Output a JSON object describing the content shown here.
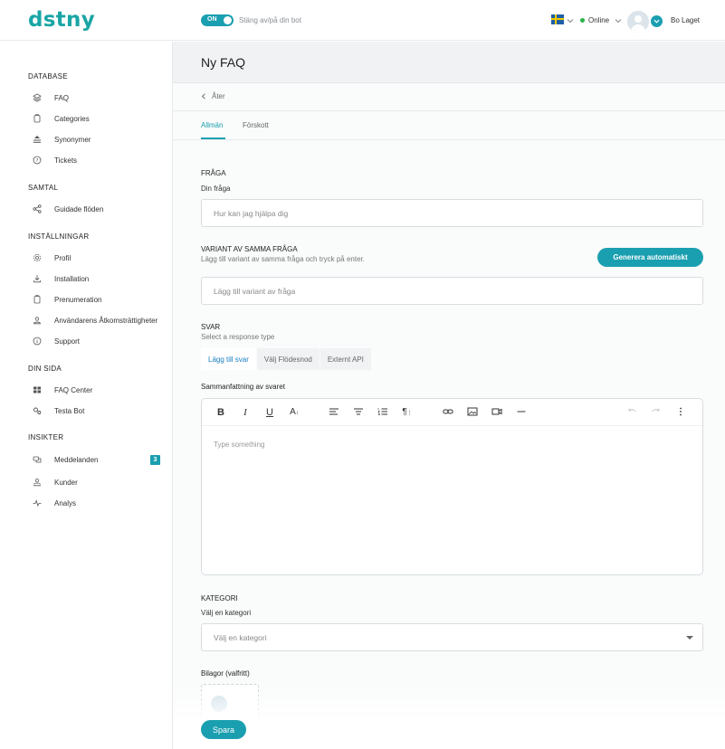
{
  "header": {
    "logo": "dstny",
    "toggle_state": "ON",
    "toggle_label": "Stäng av/på din bot",
    "flag": "sweden-flag",
    "status": "Online",
    "status_color": "#2bb34a",
    "user_name": "Bo Laget"
  },
  "sidebar": {
    "sections": [
      {
        "title": "DATABASE",
        "items": [
          {
            "label": "FAQ",
            "icon": "layers-icon"
          },
          {
            "label": "Categories",
            "icon": "folder-icon"
          },
          {
            "label": "Synonymer",
            "icon": "synonym-icon"
          },
          {
            "label": "Tickets",
            "icon": "ticket-icon"
          }
        ]
      },
      {
        "title": "SAMTAL",
        "items": [
          {
            "label": "Guidade flöden",
            "icon": "share-icon"
          }
        ]
      },
      {
        "title": "INSTÄLLNINGAR",
        "items": [
          {
            "label": "Profil",
            "icon": "gear-icon"
          },
          {
            "label": "Installation",
            "icon": "download-icon"
          },
          {
            "label": "Prenumeration",
            "icon": "document-icon"
          },
          {
            "label": "Användarens Åtkomsträttigheter",
            "icon": "users-icon"
          },
          {
            "label": "Support",
            "icon": "info-icon"
          }
        ]
      },
      {
        "title": "DIN SIDA",
        "items": [
          {
            "label": "FAQ Center",
            "icon": "grid-icon"
          },
          {
            "label": "Testa Bot",
            "icon": "cogs-icon"
          }
        ]
      },
      {
        "title": "INSIKTER",
        "items": [
          {
            "label": "Meddelanden",
            "icon": "messages-icon",
            "badge": "3"
          },
          {
            "label": "Kunder",
            "icon": "customers-icon"
          },
          {
            "label": "Analys",
            "icon": "pulse-icon"
          }
        ]
      }
    ]
  },
  "main": {
    "title": "Ny FAQ",
    "back_label": "Åter",
    "tabs": [
      {
        "label": "Allmän",
        "active": true
      },
      {
        "label": "Förskott",
        "active": false
      }
    ],
    "question": {
      "label": "FRÅGA",
      "sublabel": "Din fråga",
      "placeholder": "Hur kan jag hjälpa dig"
    },
    "variant": {
      "label": "VARIANT AV SAMMA FRÅGA",
      "sublabel": "Lägg till variant av samma fråga och tryck på enter.",
      "placeholder": "Lägg till variant av fråga",
      "generate_button": "Generera automatiskt"
    },
    "answer": {
      "label": "SVAR",
      "sublabel": "Select a response type",
      "response_tabs": [
        "Lägg till svar",
        "Välj Flödesnod",
        "Externt API"
      ],
      "active_response_tab": "Lägg till svar",
      "summary_label": "Sammanfattning av svaret",
      "editor_placeholder": "Type something"
    },
    "category": {
      "label": "KATEGORI",
      "sublabel": "Välj en kategori",
      "selected": "Välj en kategori"
    },
    "attachments_label": "Bilagor (valfritt)",
    "save_button": "Spara"
  },
  "colors": {
    "accent": "#1a9fb0",
    "brand": "#1aa5a5"
  }
}
